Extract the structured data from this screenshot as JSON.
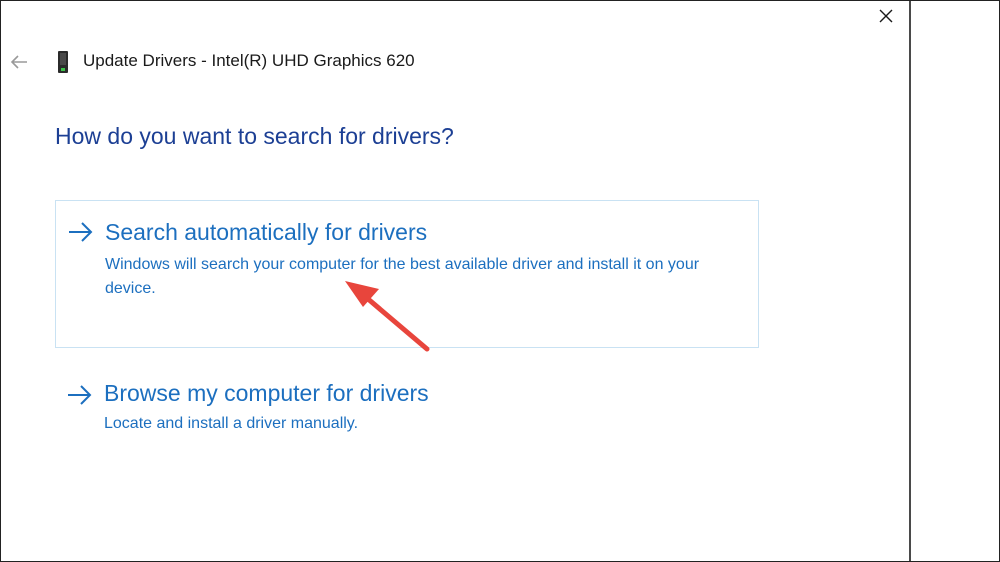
{
  "window": {
    "title": "Update Drivers - Intel(R) UHD Graphics 620",
    "close_icon": "close-icon",
    "back_icon": "back-arrow-icon",
    "device_icon": "display-adapter-icon"
  },
  "content": {
    "question": "How do you want to search for drivers?",
    "options": [
      {
        "icon": "arrow-right-icon",
        "title": "Search automatically for drivers",
        "description": "Windows will search your computer for the best available driver and install it on your device."
      },
      {
        "icon": "arrow-right-icon",
        "title": "Browse my computer for drivers",
        "description": "Locate and install a driver manually."
      }
    ]
  },
  "annotation": {
    "icon": "red-pointer-arrow-icon",
    "color": "#e8453c"
  },
  "colors": {
    "heading": "#1c3f94",
    "link": "#1c6fbf",
    "option_border": "#c9e2f3",
    "text": "#1a1a1a"
  }
}
